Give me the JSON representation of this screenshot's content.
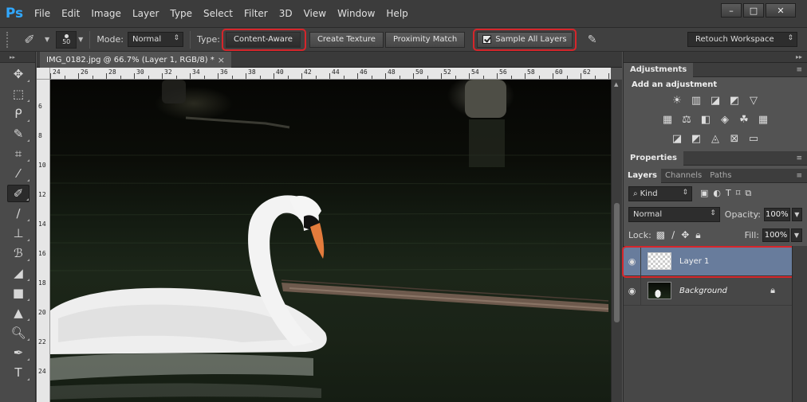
{
  "app": {
    "logo": "Ps",
    "menu": [
      "File",
      "Edit",
      "Image",
      "Layer",
      "Type",
      "Select",
      "Filter",
      "3D",
      "View",
      "Window",
      "Help"
    ],
    "window_controls": {
      "minimize": "–",
      "maximize": "□",
      "close": "✕"
    }
  },
  "options": {
    "brush_size": "50",
    "mode_label": "Mode:",
    "mode_value": "Normal",
    "type_label": "Type:",
    "type_buttons": [
      "Content-Aware",
      "Create Texture",
      "Proximity Match"
    ],
    "sample_all_layers": "Sample All Layers",
    "workspace": "Retouch Workspace"
  },
  "document": {
    "tab_title": "IMG_0182.jpg @ 66.7% (Layer 1, RGB/8) *",
    "tab_close": "×",
    "ruler_h": [
      "24",
      "26",
      "28",
      "30",
      "32",
      "34",
      "36",
      "38",
      "40",
      "42",
      "44",
      "46",
      "48",
      "50",
      "52",
      "54",
      "56",
      "58",
      "60",
      "62"
    ],
    "ruler_v": [
      "6",
      "8",
      "10",
      "12",
      "14",
      "16",
      "18",
      "20",
      "22",
      "24"
    ]
  },
  "panels": {
    "adjustments_tab": "Adjustments",
    "add_adjustment": "Add an adjustment",
    "properties_tab": "Properties",
    "layers_tabs": [
      "Layers",
      "Channels",
      "Paths"
    ],
    "kind_label": "Kind",
    "blend_mode": "Normal",
    "opacity_label": "Opacity:",
    "opacity_value": "100%",
    "lock_label": "Lock:",
    "fill_label": "Fill:",
    "fill_value": "100%",
    "layers": [
      {
        "name": "Layer 1",
        "selected": true
      },
      {
        "name": "Background",
        "selected": false,
        "locked": true
      }
    ]
  },
  "colors": {
    "highlight": "#d6262b",
    "selected_layer": "#687c9c",
    "logo": "#31a8ff"
  }
}
